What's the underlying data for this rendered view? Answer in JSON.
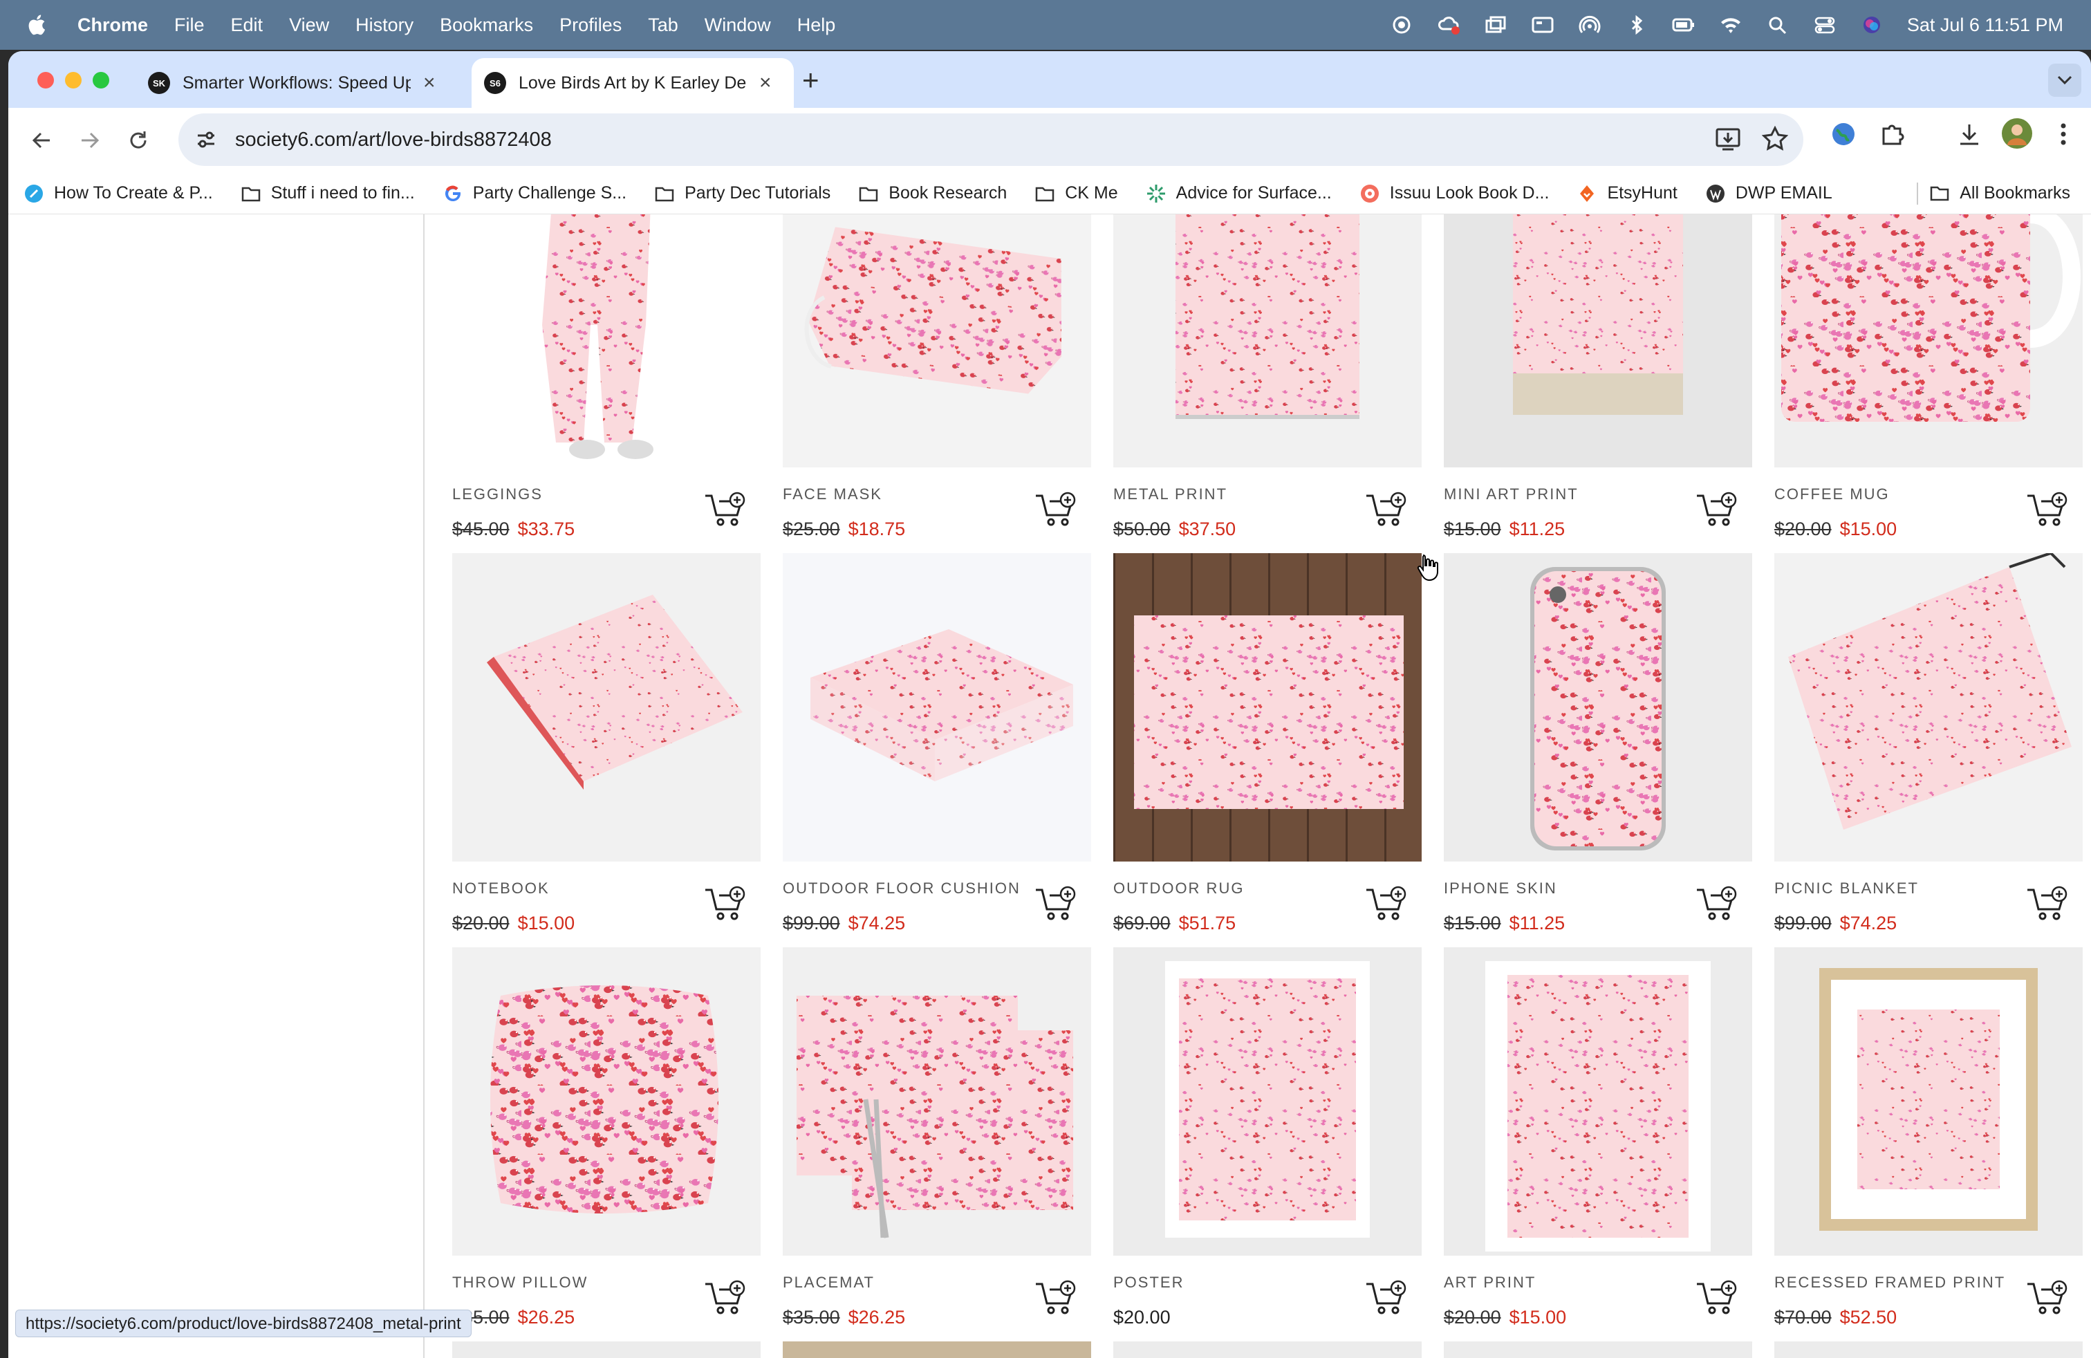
{
  "menubar": {
    "app": "Chrome",
    "items": [
      "File",
      "Edit",
      "View",
      "History",
      "Bookmarks",
      "Profiles",
      "Tab",
      "Window",
      "Help"
    ],
    "datetime": "Sat Jul 6  11:51 PM"
  },
  "tabs": [
    {
      "favicon": "SK",
      "title": "Smarter Workflows: Speed Up"
    },
    {
      "favicon": "S6",
      "title": "Love Birds Art by K Earley De"
    }
  ],
  "address": {
    "url": "society6.com/art/love-birds8872408"
  },
  "bookmarks": [
    {
      "label": "How To Create & P...",
      "icon": "blue-circle-icon"
    },
    {
      "label": "Stuff i need to fin...",
      "icon": "folder-icon"
    },
    {
      "label": "Party Challenge S...",
      "icon": "google-icon"
    },
    {
      "label": "Party Dec Tutorials",
      "icon": "folder-icon"
    },
    {
      "label": "Book Research",
      "icon": "folder-icon"
    },
    {
      "label": "CK Me",
      "icon": "folder-icon"
    },
    {
      "label": "Advice for Surface...",
      "icon": "green-burst-icon"
    },
    {
      "label": "Issuu Look Book D...",
      "icon": "issuu-icon"
    },
    {
      "label": "EtsyHunt",
      "icon": "etsyhunt-icon"
    },
    {
      "label": "DWP EMAIL",
      "icon": "wordpress-icon"
    }
  ],
  "all_bookmarks": "All Bookmarks",
  "products": [
    {
      "name": "LEGGINGS",
      "old": "$45.00",
      "new": "$33.75",
      "art": "leggings"
    },
    {
      "name": "FACE MASK",
      "old": "$25.00",
      "new": "$18.75",
      "art": "mask"
    },
    {
      "name": "METAL PRINT",
      "old": "$50.00",
      "new": "$37.50",
      "art": "metal"
    },
    {
      "name": "MINI ART PRINT",
      "old": "$15.00",
      "new": "$11.25",
      "art": "mini"
    },
    {
      "name": "COFFEE MUG",
      "old": "$20.00",
      "new": "$15.00",
      "art": "mug"
    },
    {
      "name": "NOTEBOOK",
      "old": "$20.00",
      "new": "$15.00",
      "art": "notebook"
    },
    {
      "name": "OUTDOOR FLOOR CUSHION",
      "old": "$99.00",
      "new": "$74.25",
      "art": "cushion"
    },
    {
      "name": "OUTDOOR RUG",
      "old": "$69.00",
      "new": "$51.75",
      "art": "rug"
    },
    {
      "name": "IPHONE SKIN",
      "old": "$15.00",
      "new": "$11.25",
      "art": "phone"
    },
    {
      "name": "PICNIC BLANKET",
      "old": "$99.00",
      "new": "$74.25",
      "art": "blanket"
    },
    {
      "name": "THROW PILLOW",
      "old": "$35.00",
      "new": "$26.25",
      "art": "pillow"
    },
    {
      "name": "PLACEMAT",
      "old": "$35.00",
      "new": "$26.25",
      "art": "placemat"
    },
    {
      "name": "POSTER",
      "old": "",
      "new": "",
      "regular": "$20.00",
      "art": "poster"
    },
    {
      "name": "ART PRINT",
      "old": "$20.00",
      "new": "$15.00",
      "art": "artprint"
    },
    {
      "name": "RECESSED FRAMED PRINT",
      "old": "$70.00",
      "new": "$52.50",
      "art": "framed"
    }
  ],
  "status_url": "https://society6.com/product/love-birds8872408_metal-print",
  "colors": {
    "menubar": "#5b7895",
    "tabstrip": "#d3e3fd",
    "sale": "#d22c1c",
    "pattern_bg": "#fadadd",
    "pattern_red": "#e0474c",
    "pattern_pink": "#e96aa8"
  }
}
